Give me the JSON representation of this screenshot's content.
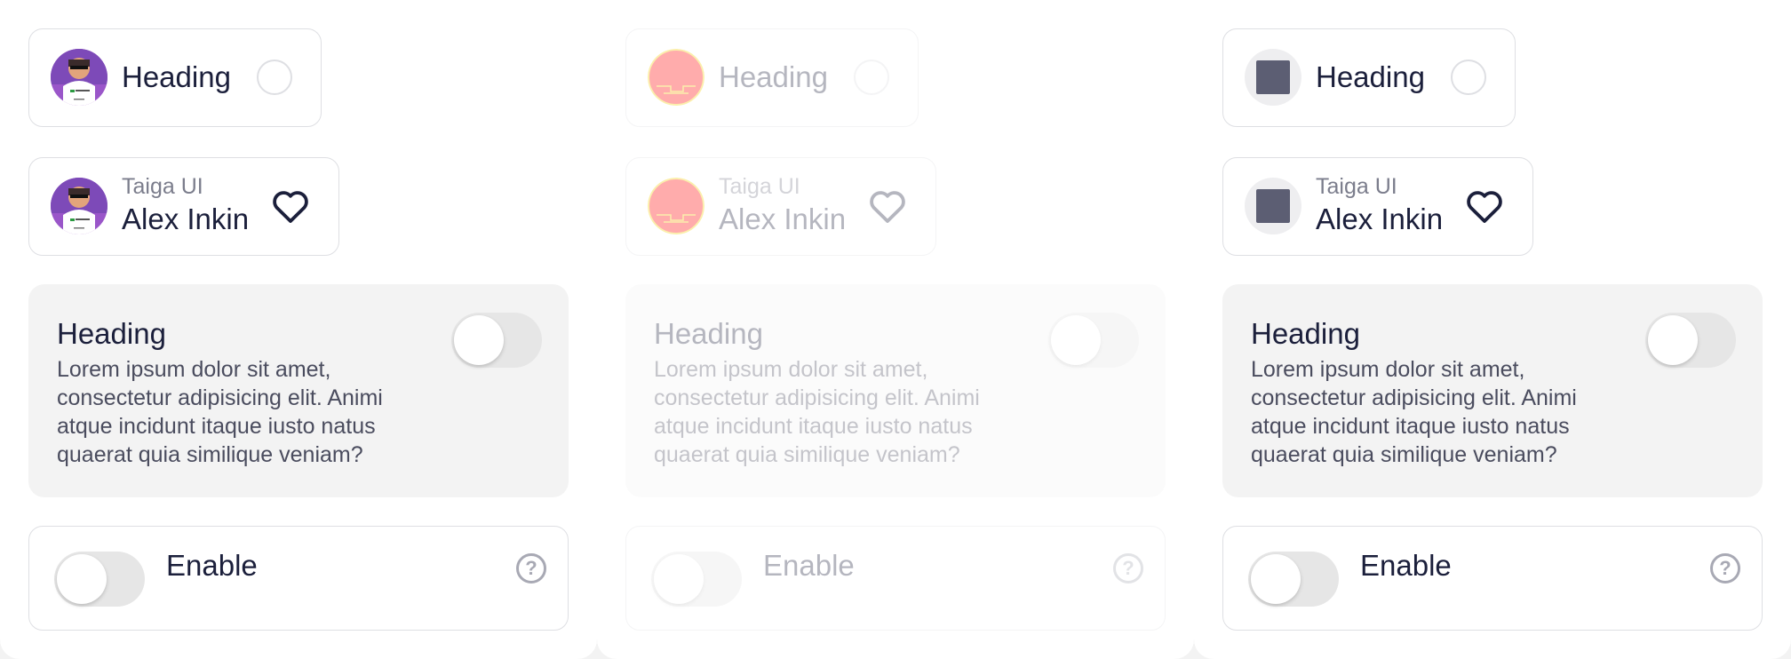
{
  "columns": [
    {
      "state": "normal",
      "avatar_style": "photo",
      "cell_heading": "Heading",
      "user_overline": "Taiga UI",
      "user_name": "Alex Inkin",
      "block_heading": "Heading",
      "block_description": "Lorem ipsum dolor sit amet, consectetur adipisicing elit. Animi atque incidunt itaque iusto natus quaerat quia similique veniam?",
      "switch_label": "Enable",
      "icons": {
        "radio": "radio-unchecked-icon",
        "heart": "heart-outline-icon",
        "help": "help-circle-icon"
      },
      "toggle_checked": false
    },
    {
      "state": "disabled",
      "avatar_style": "error",
      "cell_heading": "Heading",
      "user_overline": "Taiga UI",
      "user_name": "Alex Inkin",
      "block_heading": "Heading",
      "block_description": "Lorem ipsum dolor sit amet, consectetur adipisicing elit. Animi atque incidunt itaque iusto natus quaerat quia similique veniam?",
      "switch_label": "Enable",
      "icons": {
        "radio": "radio-unchecked-icon",
        "heart": "heart-outline-icon",
        "help": "help-circle-icon"
      },
      "toggle_checked": false
    },
    {
      "state": "normal",
      "avatar_style": "placeholder",
      "cell_heading": "Heading",
      "user_overline": "Taiga UI",
      "user_name": "Alex Inkin",
      "block_heading": "Heading",
      "block_description": "Lorem ipsum dolor sit amet, consectetur adipisicing elit. Animi atque incidunt itaque iusto natus quaerat quia similique veniam?",
      "switch_label": "Enable",
      "icons": {
        "radio": "radio-unchecked-icon",
        "heart": "heart-outline-icon",
        "help": "help-circle-icon"
      },
      "toggle_checked": false
    }
  ],
  "colors": {
    "text_primary": "#1b1f3b",
    "text_secondary": "#7b7d8c",
    "border": "#dedfe3",
    "surface": "#f3f3f3",
    "error_avatar": "#ff0000",
    "placeholder_square": "#5c5e73"
  }
}
